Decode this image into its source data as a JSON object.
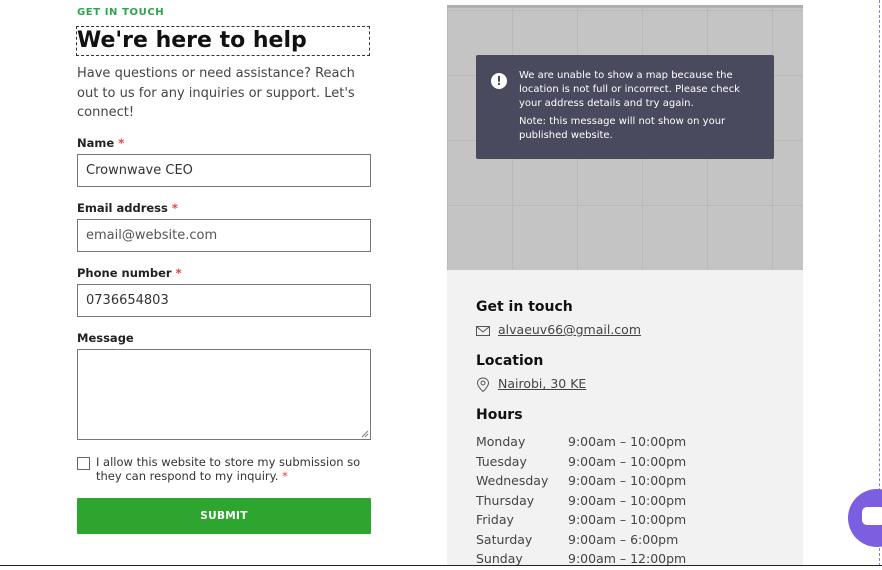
{
  "contact_form": {
    "eyebrow": "GET IN TOUCH",
    "heading": "We're here to help",
    "intro": "Have questions or need assistance? Reach out to us for any inquiries or support. Let's connect!",
    "required_mark": "*",
    "name": {
      "label": "Name",
      "value": "Crownwave CEO"
    },
    "email": {
      "label": "Email address",
      "placeholder": "email@website.com"
    },
    "phone": {
      "label": "Phone number",
      "value": "0736654803"
    },
    "message": {
      "label": "Message",
      "value": ""
    },
    "consent": "I allow this website to store my submission so they can respond to my inquiry.",
    "submit": "SUBMIT"
  },
  "map": {
    "notice": "We are unable to show a map because the location is not full or incorrect. Please check your address details and try again.",
    "note": "Note: this message will not show on your published website.",
    "notice_icon": "exclamation-circle-icon"
  },
  "contact_info": {
    "get_in_touch": {
      "title": "Get in touch",
      "email": "alvaeuv66@gmail.com",
      "icon": "envelope-icon"
    },
    "location": {
      "title": "Location",
      "address": "Nairobi, 30 KE",
      "icon": "map-pin-icon"
    },
    "hours": {
      "title": "Hours",
      "rows": [
        {
          "day": "Monday",
          "time": "9:00am  –  10:00pm"
        },
        {
          "day": "Tuesday",
          "time": "9:00am  –  10:00pm"
        },
        {
          "day": "Wednesday",
          "time": "9:00am  –  10:00pm"
        },
        {
          "day": "Thursday",
          "time": "9:00am  –  10:00pm"
        },
        {
          "day": "Friday",
          "time": "9:00am  –  10:00pm"
        },
        {
          "day": "Saturday",
          "time": "9:00am  –  6:00pm"
        },
        {
          "day": "Sunday",
          "time": "9:00am  –  12:00pm"
        }
      ]
    }
  },
  "chat_widget": {
    "icon": "chat-bubble-icon",
    "color": "#7b5fe0"
  },
  "colors": {
    "accent_green": "#2ea52e",
    "notice_bg": "#4a4a5e",
    "required": "#e0433b"
  }
}
